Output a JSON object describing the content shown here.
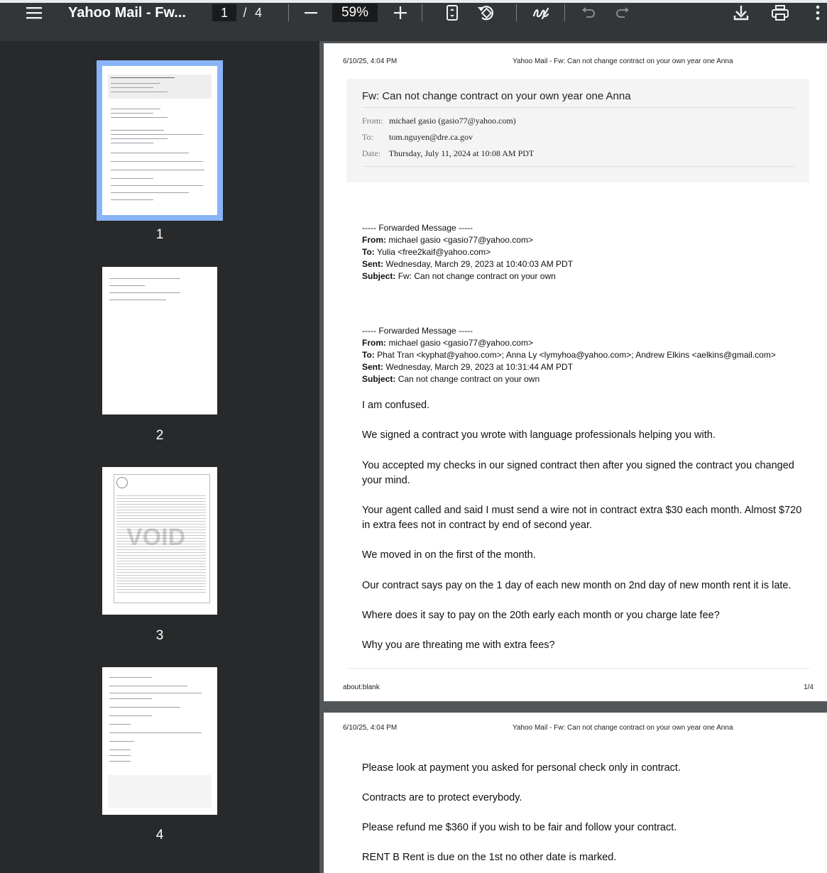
{
  "toolbar": {
    "title": "Yahoo Mail - Fw...",
    "current_page": "1",
    "page_separator": "/",
    "total_pages": "4",
    "zoom": "59%"
  },
  "sidebar": {
    "thumbnails": [
      {
        "number": "1",
        "selected": true
      },
      {
        "number": "2",
        "selected": false
      },
      {
        "number": "3",
        "selected": false,
        "watermark": "VOID"
      },
      {
        "number": "4",
        "selected": false
      }
    ]
  },
  "pages": [
    {
      "header_date": "6/10/25, 4:04 PM",
      "header_title": "Yahoo Mail - Fw: Can not change contract on your own year one Anna",
      "email": {
        "subject": "Fw: Can not change contract on your own year one Anna",
        "from_label": "From:",
        "from_value": "michael gasio (gasio77@yahoo.com)",
        "to_label": "To:",
        "to_value": "tom.nguyen@dre.ca.gov",
        "date_label": "Date:",
        "date_value": "Thursday, July 11, 2024 at 10:08 AM PDT"
      },
      "forward1": {
        "heading": "----- Forwarded Message -----",
        "from_label": "From:",
        "from": "michael gasio <gasio77@yahoo.com>",
        "to_label": "To:",
        "to": "Yulia <free2kaif@yahoo.com>",
        "sent_label": "Sent:",
        "sent": "Wednesday, March 29, 2023 at 10:40:03 AM PDT",
        "subject_label": "Subject:",
        "subject": "Fw: Can not change contract on your own"
      },
      "forward2": {
        "heading": "----- Forwarded Message -----",
        "from_label": "From:",
        "from": "michael gasio <gasio77@yahoo.com>",
        "to_label": "To:",
        "to": "Phat Tran <kyphat@yahoo.com>; Anna Ly <lymyhoa@yahoo.com>; Andrew Elkins <aelkins@gmail.com>",
        "sent_label": "Sent:",
        "sent": "Wednesday, March 29, 2023 at 10:31:44 AM PDT",
        "subject_label": "Subject:",
        "subject": "Can not change contract on your own"
      },
      "body": [
        "I am confused.",
        "We signed a contract you wrote with language professionals helping you with.",
        "You accepted my checks in our signed contract then after you signed the contract you changed your mind.",
        "Your agent called and said I must send a wire not in contract extra $30 each month. Almost $720 in extra fees not in contract by end of second year.",
        "We moved in on the first of the month.",
        "Our contract says pay on the 1 day of each new month on 2nd day of new month rent it is late.",
        "Where does it say to pay on the 20th early each month or you charge late fee?",
        "Why you are threating me with extra fees?"
      ],
      "footer_left": "about:blank",
      "footer_right": "1/4"
    },
    {
      "header_date": "6/10/25, 4:04 PM",
      "header_title": "Yahoo Mail - Fw: Can not change contract on your own year one Anna",
      "body": [
        "Please look at payment you asked for personal check only in contract.",
        "Contracts are to protect everybody.",
        "Please refund me $360 if you wish to be fair and follow your contract.",
        "RENT B Rent is due on the 1st no other date is marked."
      ]
    }
  ],
  "colors": {
    "toolbar_bg": "#323639",
    "sidebar_bg": "#27292b",
    "viewer_bg": "#525659",
    "thumb_selected": "#8ab4f8"
  }
}
